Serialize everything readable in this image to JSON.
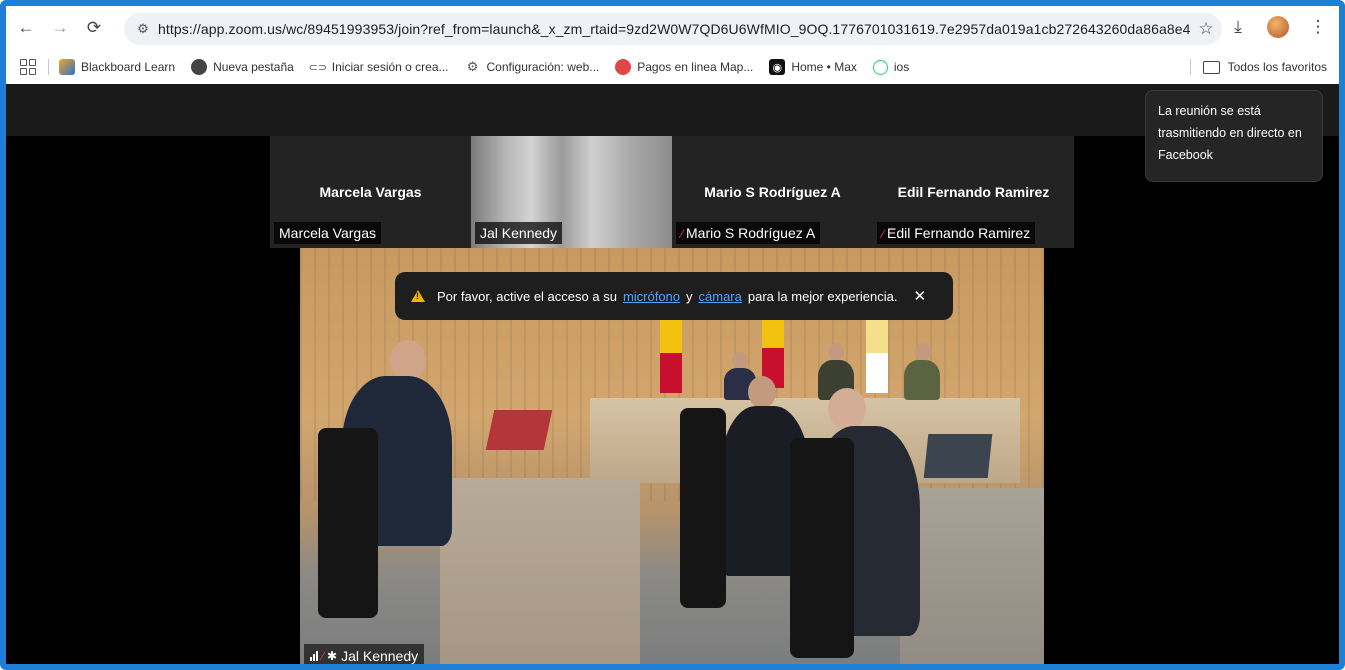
{
  "browser": {
    "url": "https://app.zoom.us/wc/89451993953/join?ref_from=launch&_x_zm_rtaid=9zd2W0W7QD6U6WfMIO_9OQ.1776701031619.7e2957da019a1cb272643260da86a8e4&_x_...",
    "bookmarks": [
      {
        "label": "Blackboard Learn"
      },
      {
        "label": "Nueva pestaña"
      },
      {
        "label": "Iniciar sesión o crea..."
      },
      {
        "label": "Configuración: web..."
      },
      {
        "label": "Pagos en linea Map..."
      },
      {
        "label": "Home • Max"
      },
      {
        "label": "ios"
      }
    ],
    "all_bookmarks_label": "Todos los favoritos"
  },
  "meeting": {
    "tooltip": "La reunión se está trasmitiendo en directo en Facebook",
    "participants": [
      {
        "center_name": "Marcela Vargas",
        "label": "Marcela Vargas",
        "muted": false,
        "video": false
      },
      {
        "center_name": "",
        "label": "Jal Kennedy",
        "muted": false,
        "video": true
      },
      {
        "center_name": "Mario S Rodríguez A",
        "label": "Mario S Rodríguez A",
        "muted": true,
        "video": false
      },
      {
        "center_name": "Edil Fernando Ramirez",
        "label": "Edil Fernando Ramirez",
        "muted": true,
        "video": false
      }
    ],
    "banner": {
      "text_before": "Por favor, active el acceso a su",
      "link_mic": "micrófono",
      "conj": "y",
      "link_cam": "cámara",
      "text_after": "para la mejor experiencia.",
      "close": "✕"
    },
    "active_speaker": "Jal Kennedy"
  }
}
